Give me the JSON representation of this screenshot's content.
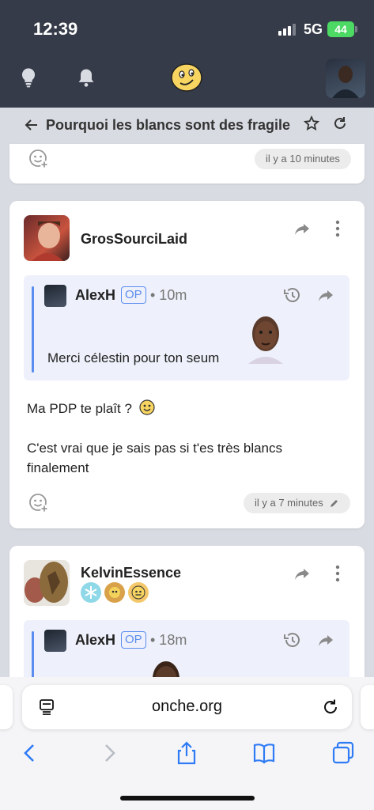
{
  "status_bar": {
    "time": "12:39",
    "network": "5G",
    "battery": "44"
  },
  "app_header": {
    "icons": [
      "lightbulb-icon",
      "bell-icon",
      "smiley-logo-icon",
      "profile-avatar"
    ]
  },
  "topic": {
    "title": "Pourquoi les blancs sont des fragile",
    "icons": [
      "back-arrow-icon",
      "star-icon",
      "refresh-icon"
    ]
  },
  "posts": [
    {
      "time": "il y a 10 minutes"
    },
    {
      "author": "GrosSourciLaid",
      "quote": {
        "author": "AlexH",
        "op_badge": "OP",
        "ago": "• 10m",
        "text": "Merci célestin pour ton seum"
      },
      "body_line1": "Ma PDP te plaît ?",
      "body_line2": "C'est vrai que je sais pas si t'es très blancs",
      "body_line3": "finalement",
      "time": "il y a 7 minutes"
    },
    {
      "author": "KelvinEssence",
      "badges": [
        "snowflake-badge",
        "cartoon-badge",
        "emoji-badge"
      ],
      "quote": {
        "author": "AlexH",
        "op_badge": "OP",
        "ago": "• 18m"
      }
    }
  ],
  "browser": {
    "url": "onche.org",
    "toolbar": [
      "back-icon",
      "forward-icon",
      "share-icon",
      "bookmarks-icon",
      "tabs-icon"
    ]
  },
  "colors": {
    "header_bg": "#353b48",
    "accent": "#5b8def",
    "battery": "#4cd964",
    "quote_bg": "#eef1fb"
  }
}
